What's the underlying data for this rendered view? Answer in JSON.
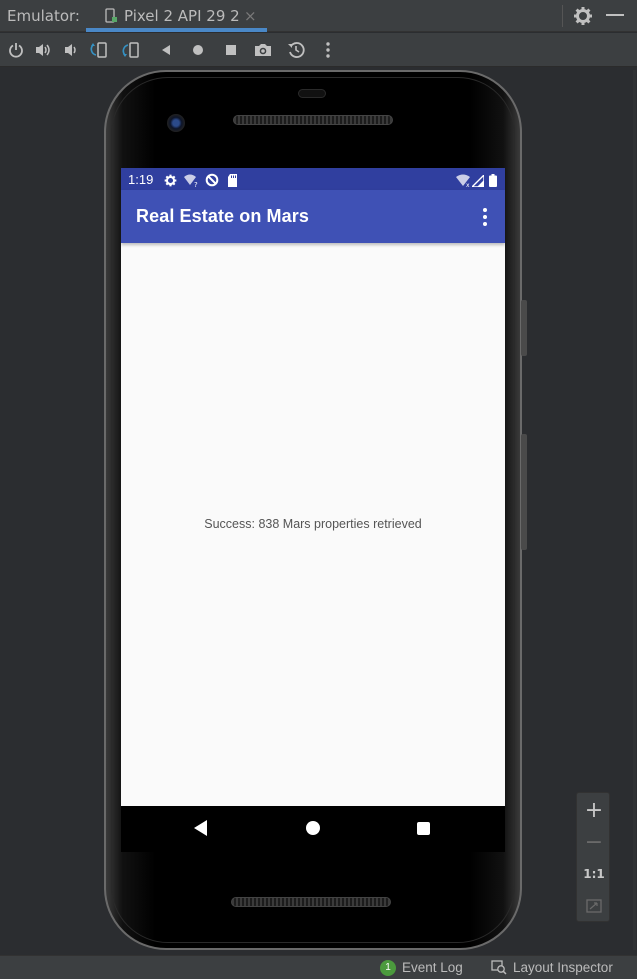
{
  "ide": {
    "panel_title": "Emulator:",
    "tab_label": "Pixel 2 API 29 2",
    "tab_close": "×",
    "colors": {
      "accent": "#4a88c7",
      "panel": "#3c3f41",
      "background": "#2b2d30"
    }
  },
  "toolbar": {
    "buttons": [
      "power-icon",
      "volume-up-icon",
      "volume-down-icon",
      "rotate-left-icon",
      "rotate-right-icon",
      "back-icon",
      "home-icon",
      "overview-icon",
      "screenshot-icon",
      "snapshot-icon",
      "more-icon"
    ]
  },
  "device": {
    "status_bar": {
      "time": "1:19",
      "color": "#303f9f"
    },
    "app_bar": {
      "title": "Real Estate on Mars",
      "color": "#3f51b5"
    },
    "content": {
      "message": "Success: 838 Mars properties retrieved"
    }
  },
  "zoom": {
    "zoom_in": "+",
    "zoom_out": "−",
    "actual_size": "1:1"
  },
  "bottom_bar": {
    "event_count": "1",
    "event_log": "Event Log",
    "layout_inspector": "Layout Inspector"
  }
}
